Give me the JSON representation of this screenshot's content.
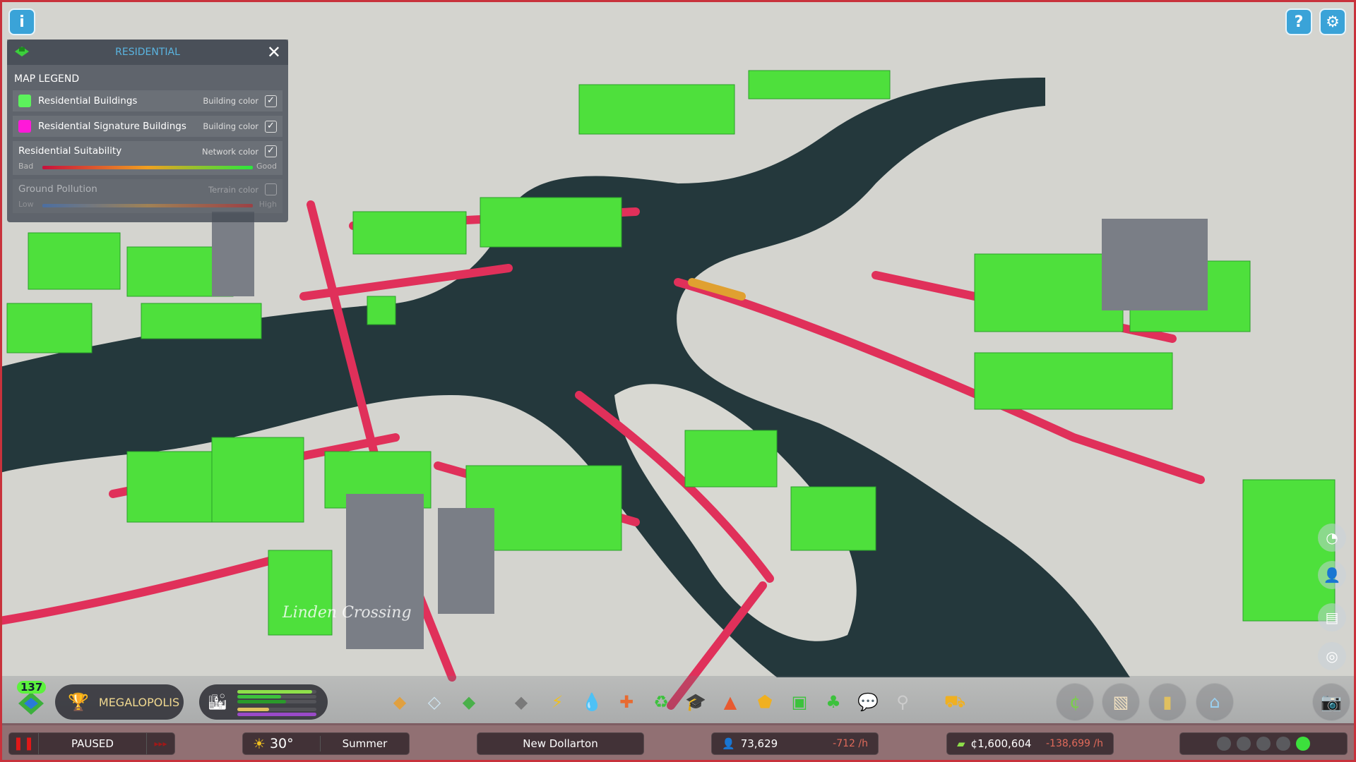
{
  "top": {
    "info_icon": "info-icon",
    "help_icon": "question-icon",
    "settings_icon": "gear-icon"
  },
  "legend": {
    "title": "RESIDENTIAL",
    "heading": "MAP LEGEND",
    "items": [
      {
        "label": "Residential Buildings",
        "option": "Building color",
        "checked": true,
        "color": "#5cf25c"
      },
      {
        "label": "Residential Signature Buildings",
        "option": "Building color",
        "checked": true,
        "color": "#ff19d9"
      }
    ],
    "suitability": {
      "label": "Residential Suitability",
      "option": "Network color",
      "checked": true,
      "low": "Bad",
      "high": "Good"
    },
    "pollution": {
      "label": "Ground Pollution",
      "option": "Terrain color",
      "checked": false,
      "low": "Low",
      "high": "High"
    }
  },
  "map": {
    "district_label": "Linden Crossing"
  },
  "toolbar": {
    "level": "137",
    "milestone": "MEGALOPOLIS",
    "demand_bars": [
      {
        "color": "#8ee04a",
        "value": 0.95
      },
      {
        "color": "#3cc23c",
        "value": 0.55
      },
      {
        "color": "#2a9a2a",
        "value": 0.62
      },
      {
        "color": "#e0c060",
        "value": 0.4
      },
      {
        "color": "#9a4ac8",
        "value": 1.0
      }
    ],
    "tools": [
      "zoning-icon",
      "area-icon",
      "signature-buildings-icon",
      "roads-icon",
      "electricity-icon",
      "water-icon",
      "healthcare-icon",
      "garbage-icon",
      "education-icon",
      "fire-icon",
      "police-icon",
      "transportation-icon",
      "parks-icon",
      "communication-icon",
      "landscaping-icon",
      "bulldozer-icon"
    ],
    "right_tools": [
      "economy-icon",
      "map-layers-icon",
      "statistics-icon",
      "progression-icon"
    ],
    "camera_icon": "camera-icon"
  },
  "status": {
    "pause_state": "PAUSED",
    "temperature": "30°",
    "season": "Summer",
    "city_name": "New Dollarton",
    "population": "73,629",
    "population_rate": "-712 /h",
    "money": "¢1,600,604",
    "money_rate": "-138,699 /h",
    "happiness_level": 5
  },
  "colors": {
    "accent": "#3aa3d8",
    "road_red": "#e0305a",
    "residential_green": "#5cf25c",
    "water": "#24383c"
  }
}
